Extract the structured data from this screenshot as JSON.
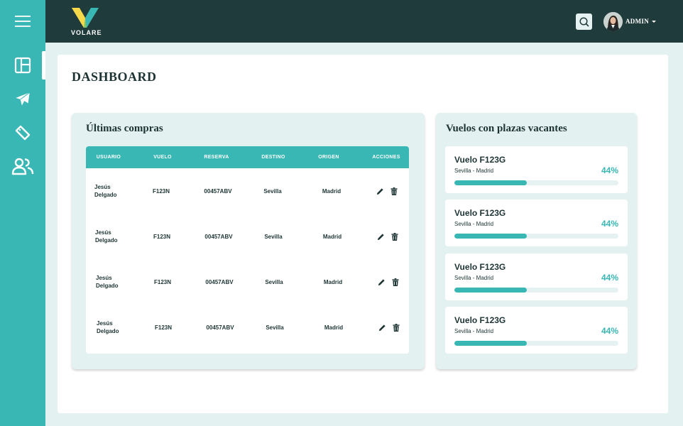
{
  "brand": {
    "name": "VOLARE",
    "accent": "#38b7b5",
    "dark": "#203b3b",
    "logo_colors": [
      "#f5d94a",
      "#7cc36a",
      "#38b7b5"
    ]
  },
  "sidebar": {
    "items": [
      {
        "name": "dashboard",
        "icon": "dashboard-icon",
        "active": true
      },
      {
        "name": "flights",
        "icon": "airplane-icon",
        "active": false
      },
      {
        "name": "tickets",
        "icon": "ticket-icon",
        "active": false
      },
      {
        "name": "users",
        "icon": "users-icon",
        "active": false
      }
    ]
  },
  "header": {
    "user_name": "ADMIN"
  },
  "page": {
    "title": "DASHBOARD"
  },
  "purchases": {
    "title": "Últimas compras",
    "columns": [
      "USUARIO",
      "VUELO",
      "RESERVA",
      "DESTINO",
      "ORIGEN",
      "ACCIONES"
    ],
    "rows": [
      {
        "usuario": "Jesús Delgado",
        "vuelo": "F123N",
        "reserva": "00457ABV",
        "destino": "Sevilla",
        "origen": "Madrid"
      },
      {
        "usuario": "Jesús Delgado",
        "vuelo": "F123N",
        "reserva": "00457ABV",
        "destino": "Sevilla",
        "origen": "Madrid"
      },
      {
        "usuario": "Jesús Delgado",
        "vuelo": "F123N",
        "reserva": "00457ABV",
        "destino": "Sevilla",
        "origen": "Madrid"
      },
      {
        "usuario": "Jesús Delgado",
        "vuelo": "F123N",
        "reserva": "00457ABV",
        "destino": "Sevilla",
        "origen": "Madrid"
      }
    ]
  },
  "vacancies": {
    "title": "Vuelos con plazas vacantes",
    "flights": [
      {
        "title": "Vuelo F123G",
        "route": "Sevilla - Madrid",
        "percent_label": "44%",
        "percent": 44
      },
      {
        "title": "Vuelo F123G",
        "route": "Sevilla - Madrid",
        "percent_label": "44%",
        "percent": 44
      },
      {
        "title": "Vuelo F123G",
        "route": "Sevilla - Madrid",
        "percent_label": "44%",
        "percent": 44
      },
      {
        "title": "Vuelo F123G",
        "route": "Sevilla - Madrid",
        "percent_label": "44%",
        "percent": 44
      }
    ]
  }
}
